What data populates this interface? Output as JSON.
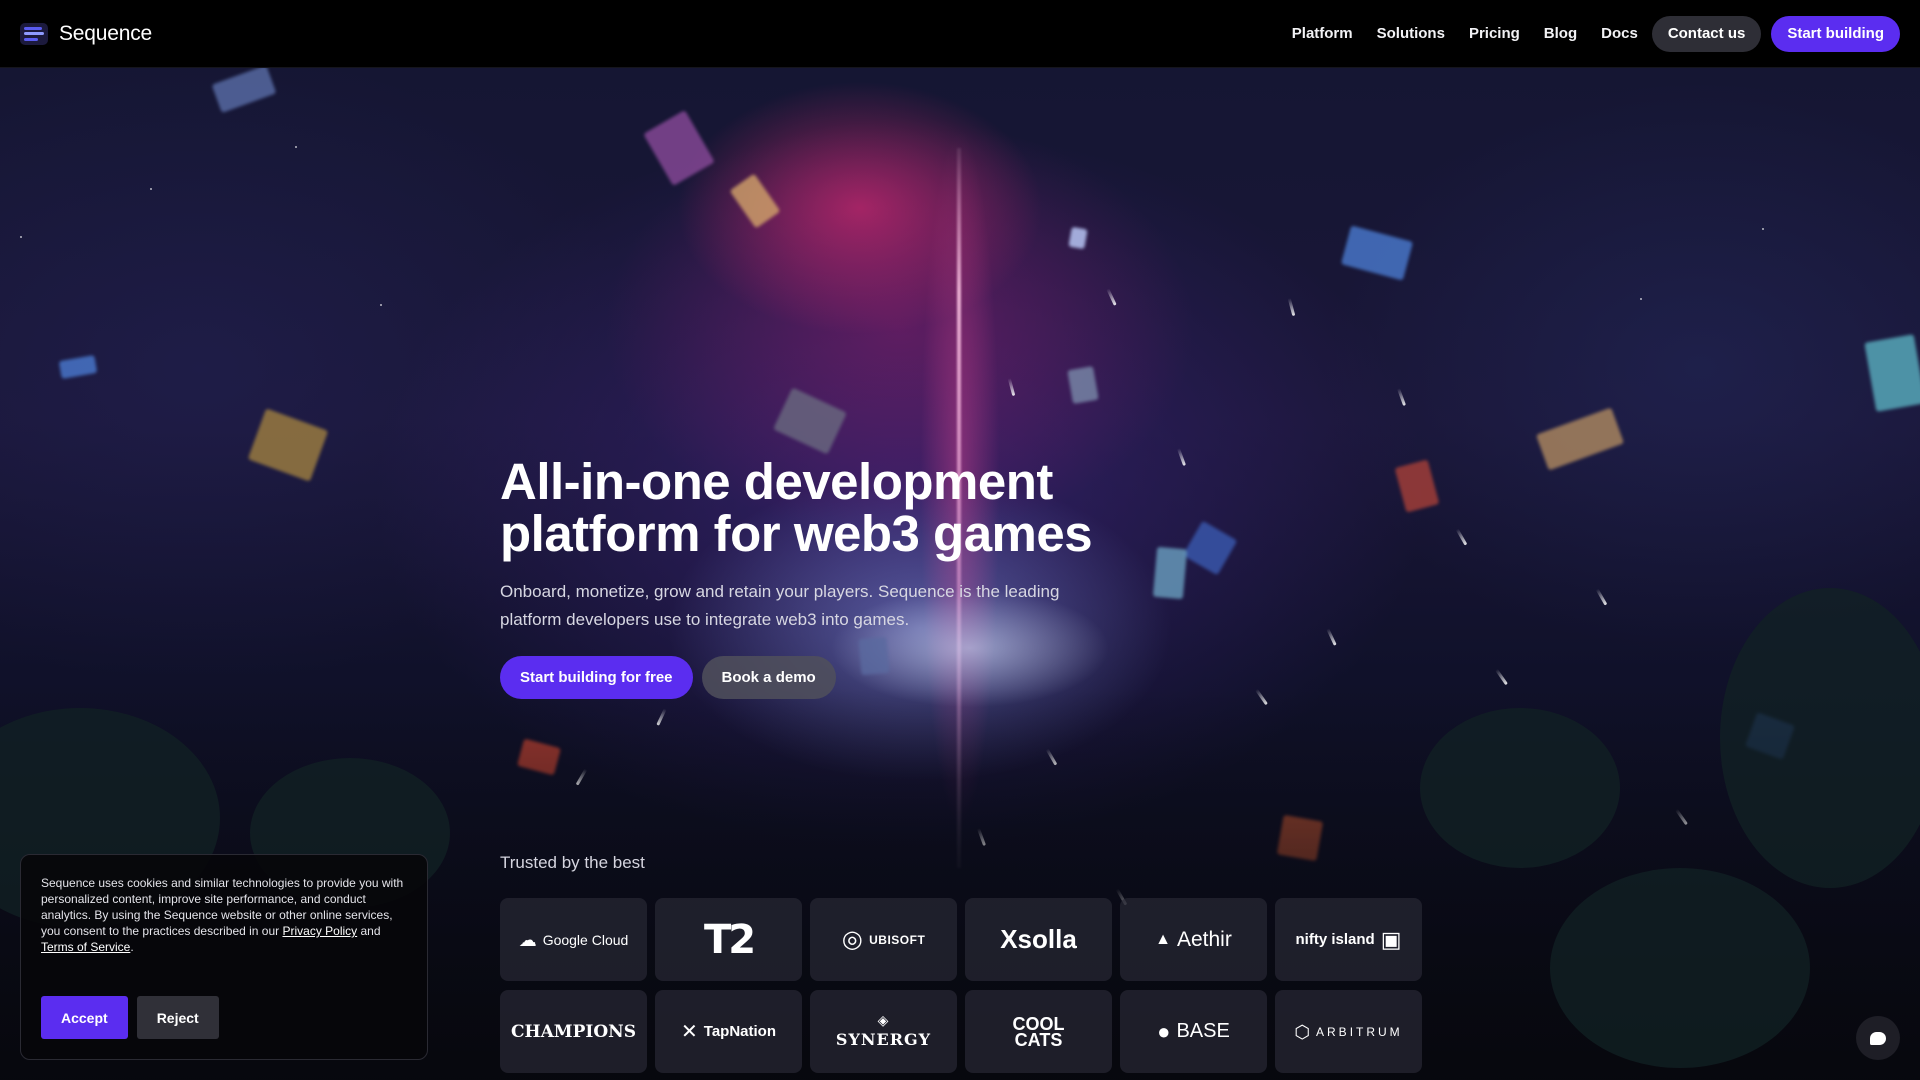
{
  "brand": {
    "name": "Sequence",
    "logo_icon": "sequence-logo-icon"
  },
  "nav": {
    "links": [
      "Platform",
      "Solutions",
      "Pricing",
      "Blog",
      "Docs"
    ],
    "contact_label": "Contact us",
    "start_label": "Start building"
  },
  "hero": {
    "title_line1": "All-in-one development",
    "title_line2": "platform for web3 games",
    "subtitle": "Onboard, monetize, grow and retain your players. Sequence is the leading platform developers use to integrate web3 into games.",
    "cta_primary": "Start building for free",
    "cta_secondary": "Book a demo"
  },
  "trusted": {
    "label": "Trusted by the best",
    "logos": [
      {
        "name": "Google Cloud",
        "icon": "cloud-icon",
        "glyph": "☁"
      },
      {
        "name": "T2",
        "icon": "",
        "glyph": ""
      },
      {
        "name": "UBISOFT",
        "icon": "ubisoft-swirl-icon",
        "glyph": "◎"
      },
      {
        "name": "Xsolla",
        "icon": "",
        "glyph": ""
      },
      {
        "name": "Aethir",
        "icon": "aethir-a-icon",
        "glyph": "▲"
      },
      {
        "name": "nifty island",
        "icon": "nifty-island-badge-icon",
        "glyph": "▣"
      },
      {
        "name": "CHAMPIONS",
        "icon": "",
        "glyph": ""
      },
      {
        "name": "TapNation",
        "icon": "tapnation-x-icon",
        "glyph": "✕"
      },
      {
        "name": "SYNERGY",
        "icon": "synergy-diamond-icon",
        "glyph": "◈"
      },
      {
        "name": "COOL CATS",
        "icon": "",
        "glyph": ""
      },
      {
        "name": "BASE",
        "icon": "base-circle-icon",
        "glyph": "●"
      },
      {
        "name": "ARBITRUM",
        "icon": "arbitrum-hex-icon",
        "glyph": "⬡"
      }
    ]
  },
  "cookie": {
    "text": "Sequence uses cookies and similar technologies to provide you with personalized content, improve site performance, and conduct analytics. By using the Sequence website or other online services, you consent to the practices described in our ",
    "privacy_label": "Privacy Policy",
    "and_text": " and ",
    "terms_label": "Terms of Service",
    "end_text": ".",
    "accept_label": "Accept",
    "reject_label": "Reject"
  },
  "chat": {
    "icon": "chat-bubble-icon"
  },
  "colors": {
    "accent": "#5b2df0",
    "nav_bg": "#000000",
    "pill_dark": "#2e2e36"
  }
}
